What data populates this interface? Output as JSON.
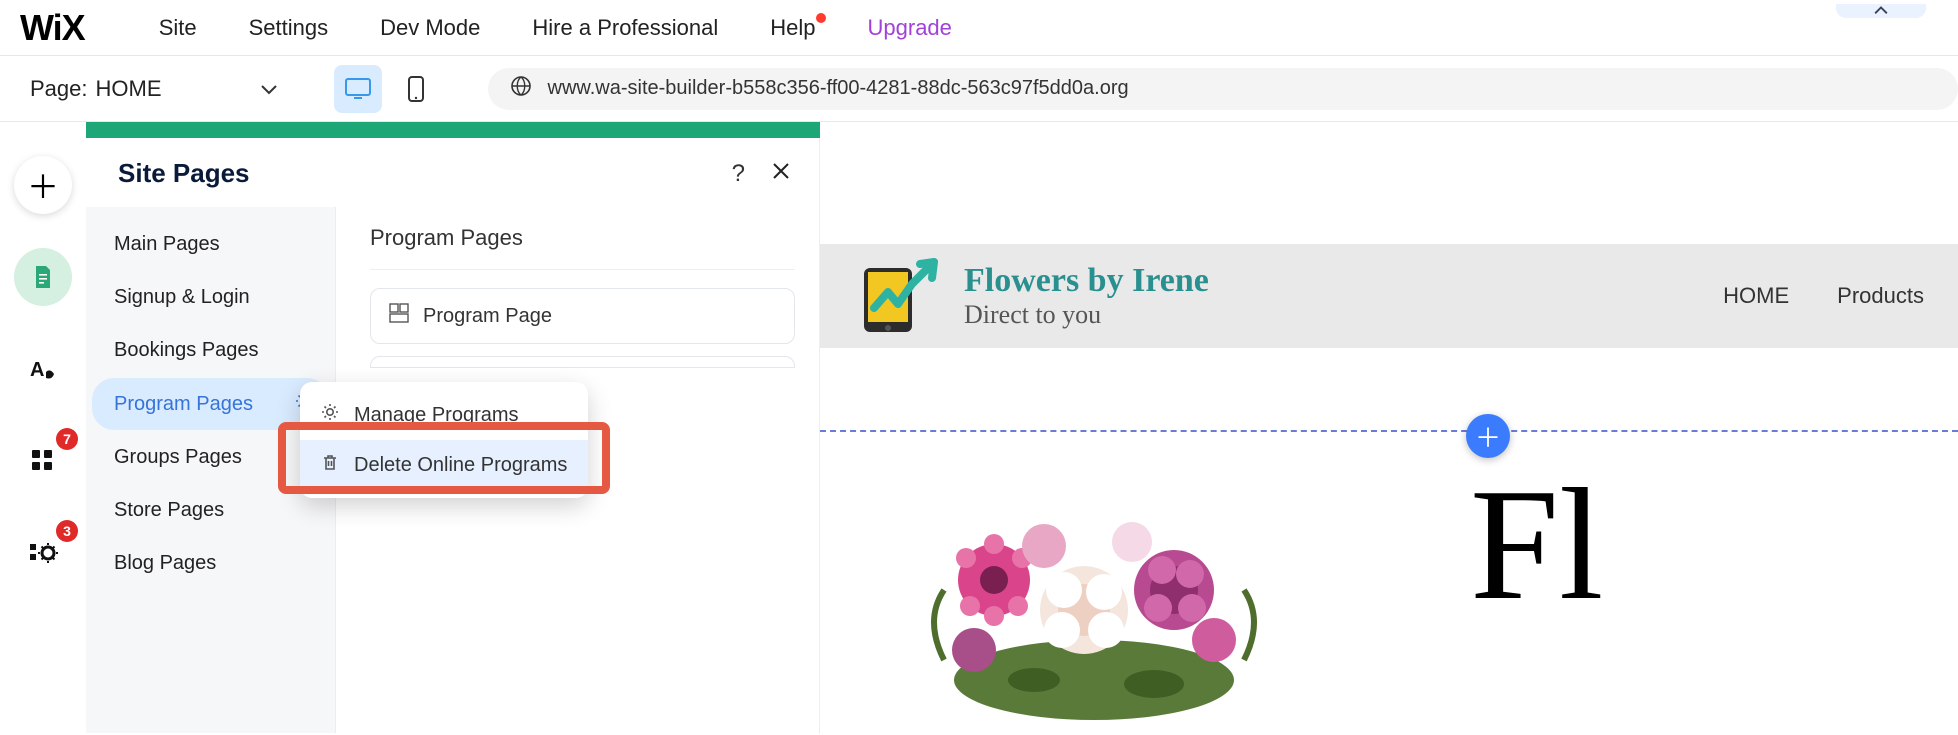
{
  "topMenu": {
    "site": "Site",
    "settings": "Settings",
    "devMode": "Dev Mode",
    "hire": "Hire a Professional",
    "help": "Help",
    "upgrade": "Upgrade"
  },
  "secondBar": {
    "pageLabel": "Page:",
    "currentPage": "HOME",
    "url": "www.wa-site-builder-b558c356-ff00-4281-88dc-563c97f5dd0a.org"
  },
  "railBadges": {
    "apps": "7",
    "tools": "3"
  },
  "panel": {
    "title": "Site Pages",
    "categories": [
      "Main Pages",
      "Signup & Login",
      "Bookings Pages",
      "Program Pages",
      "Groups Pages",
      "Store Pages",
      "Blog Pages"
    ],
    "selectedCategory": "Program Pages",
    "sectionTitle": "Program Pages",
    "pages": [
      "Program Page"
    ],
    "contextMenu": {
      "manage": "Manage Programs",
      "delete": "Delete Online Programs"
    }
  },
  "sitePreview": {
    "brandTitle": "Flowers by Irene",
    "brandSubtitle": "Direct to you",
    "nav": {
      "home": "HOME",
      "products": "Products"
    },
    "heroPartial": "Fl"
  }
}
